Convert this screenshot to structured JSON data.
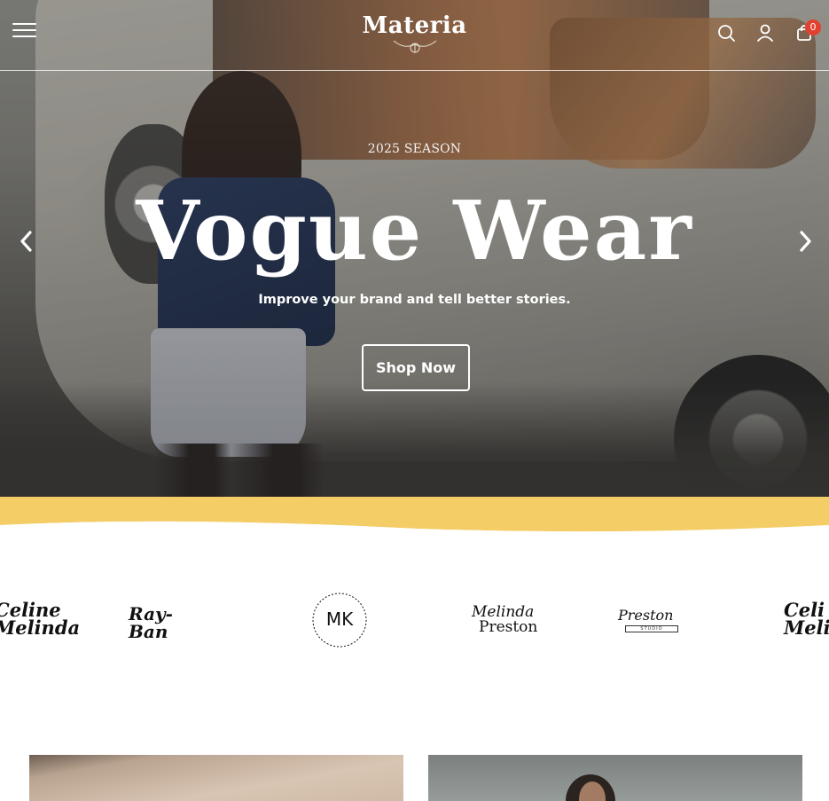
{
  "header": {
    "logo_text": "Materia",
    "cart_count": "0",
    "icons": [
      "menu-icon",
      "search-icon",
      "account-icon",
      "cart-icon"
    ]
  },
  "hero": {
    "eyebrow": "2025 SEASON",
    "title": "Vogue Wear",
    "subtitle": "Improve your brand and tell better stories.",
    "cta_label": "Shop Now"
  },
  "brands": {
    "items": [
      {
        "name": "Celine Melinda",
        "line1": "Celine",
        "line2": "Melinda"
      },
      {
        "name": "Ray-Ban",
        "text": "Ray-Ban"
      },
      {
        "name": "MK",
        "text": "MK"
      },
      {
        "name": "Melinda Preston",
        "line1": "Melinda",
        "line2": "Preston"
      },
      {
        "name": "Preston",
        "text": "Preston",
        "caption": "STUDIO"
      },
      {
        "name": "Celine Melinda",
        "line1": "Celi",
        "line2": "Melin"
      }
    ]
  },
  "colors": {
    "accent_yellow": "#f4cd66",
    "badge_red": "#e2412f",
    "text_white": "#ffffff"
  }
}
